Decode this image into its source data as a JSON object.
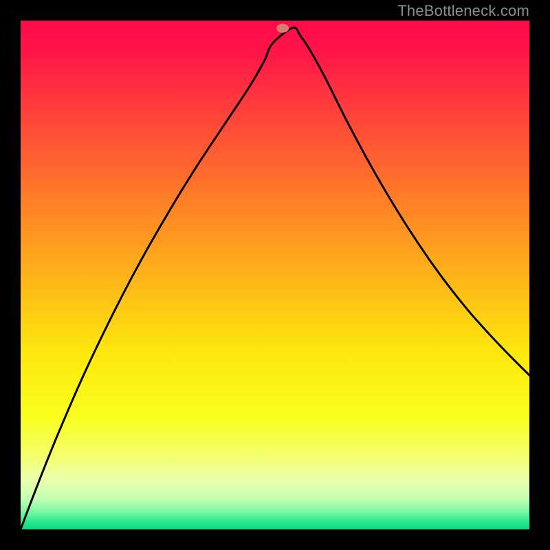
{
  "attribution": "TheBottleneck.com",
  "chart_data": {
    "type": "line",
    "title": "",
    "xlabel": "",
    "ylabel": "",
    "xlim": [
      0,
      100
    ],
    "ylim": [
      0,
      100
    ],
    "grid": false,
    "legend": false,
    "background_gradient": {
      "stops": [
        {
          "offset": 0.0,
          "color": "#ff0a4a"
        },
        {
          "offset": 0.06,
          "color": "#ff1548"
        },
        {
          "offset": 0.2,
          "color": "#ff4838"
        },
        {
          "offset": 0.35,
          "color": "#ff7d28"
        },
        {
          "offset": 0.5,
          "color": "#ffb31a"
        },
        {
          "offset": 0.65,
          "color": "#fde70e"
        },
        {
          "offset": 0.78,
          "color": "#f8ff1e"
        },
        {
          "offset": 0.86,
          "color": "#f4ff72"
        },
        {
          "offset": 0.9,
          "color": "#ecffab"
        },
        {
          "offset": 0.94,
          "color": "#c3ffb3"
        },
        {
          "offset": 0.965,
          "color": "#7df7a2"
        },
        {
          "offset": 0.985,
          "color": "#29e88d"
        },
        {
          "offset": 1.0,
          "color": "#0fd884"
        }
      ]
    },
    "marker": {
      "x": 51.5,
      "y": 98.5,
      "color": "#d77d70"
    },
    "series": [
      {
        "name": "curve",
        "x": [
          0,
          2,
          5,
          8,
          12,
          16,
          20,
          24,
          28,
          32,
          36,
          40,
          44,
          46,
          48,
          49.5,
          53.5,
          55,
          57,
          60,
          64,
          68,
          72,
          76,
          80,
          84,
          88,
          92,
          96,
          100
        ],
        "y": [
          0,
          5.3,
          13,
          20.3,
          29.5,
          38,
          46,
          53.5,
          60.5,
          67.2,
          73.5,
          79.5,
          85.5,
          88.7,
          92.3,
          95.5,
          98.6,
          97,
          94,
          88.5,
          80.5,
          73,
          66,
          59.5,
          53.5,
          48,
          43,
          38.5,
          34.3,
          30.3
        ]
      }
    ]
  }
}
